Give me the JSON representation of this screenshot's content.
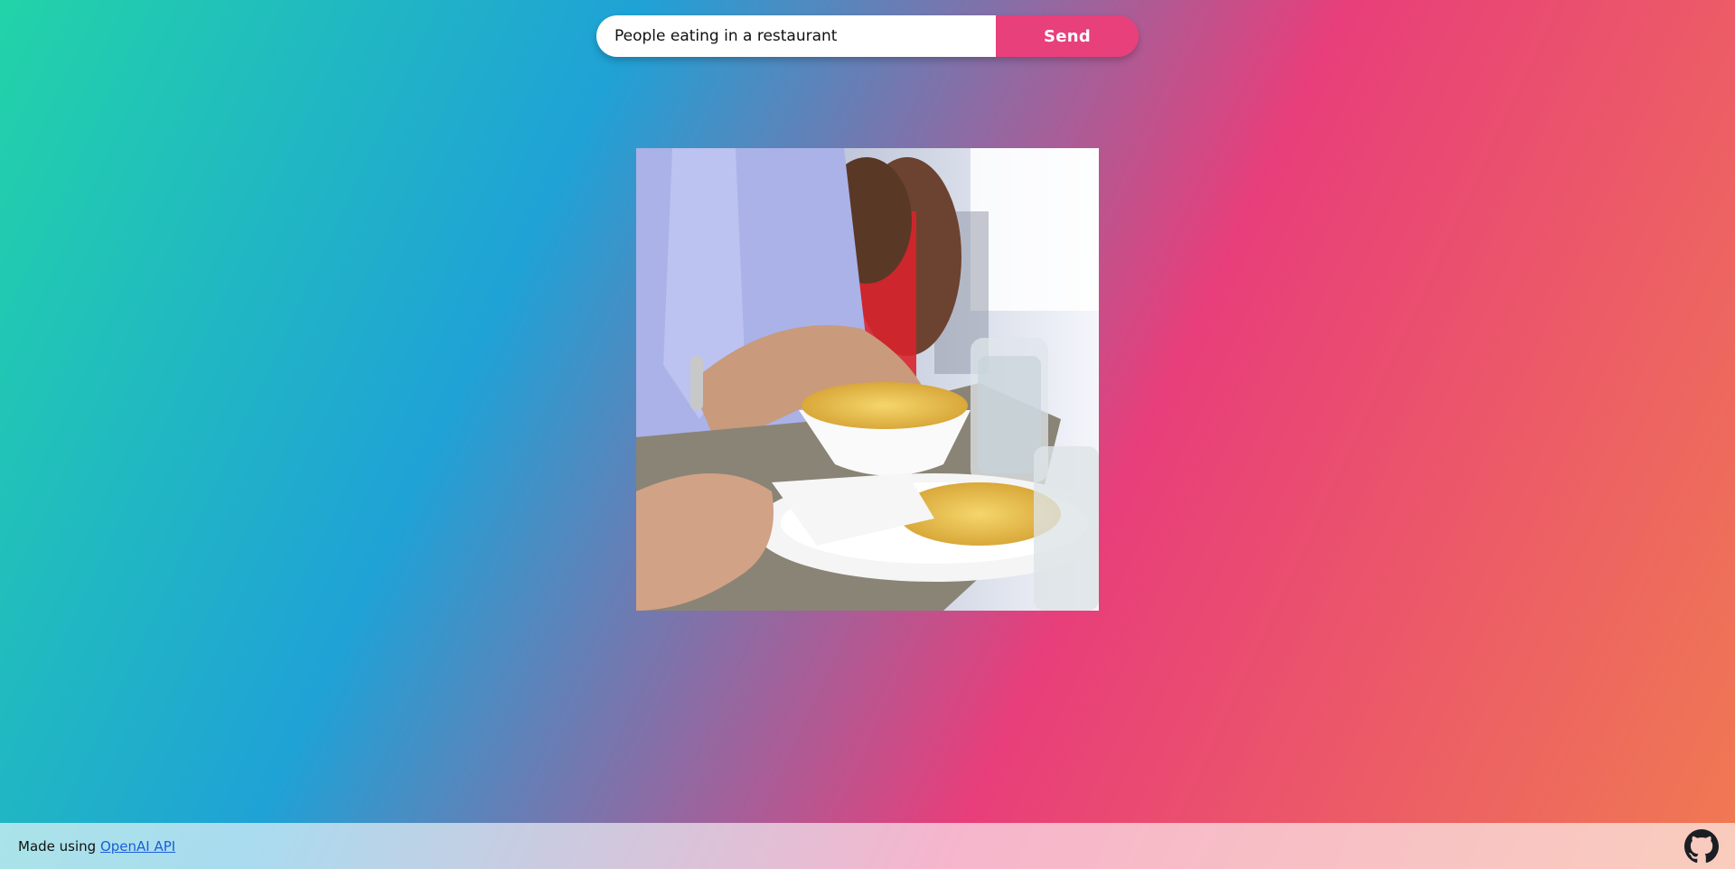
{
  "prompt": {
    "value": "People eating in a restaurant",
    "send_label": "Send"
  },
  "image": {
    "alt": "People eating in a restaurant"
  },
  "footer": {
    "made_using": "Made using ",
    "link_label": "OpenAI API",
    "github_icon": "github-icon"
  },
  "colors": {
    "accent": "#e8407a",
    "gradient_start": "#22d3a8",
    "gradient_mid": "#1fa2d6",
    "gradient_pink": "#e83e7a",
    "gradient_end": "#f07a52",
    "link": "#1a5fd8"
  }
}
